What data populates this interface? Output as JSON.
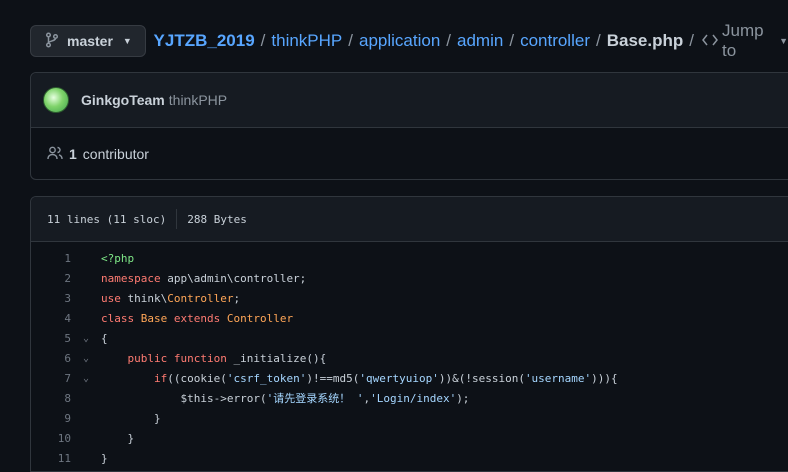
{
  "branch": {
    "label": "master"
  },
  "breadcrumb": {
    "repo": "YJTZB_2019",
    "parts": [
      "thinkPHP",
      "application",
      "admin",
      "controller"
    ],
    "file": "Base.php",
    "separator": "/",
    "jump_label": "Jump to"
  },
  "commit": {
    "author": "GinkgoTeam",
    "message": "thinkPHP"
  },
  "contributors": {
    "count": "1",
    "label": "contributor"
  },
  "file_info": {
    "lines": "11 lines (11 sloc)",
    "size": "288 Bytes"
  },
  "code": {
    "line_numbers": [
      "1",
      "2",
      "3",
      "4",
      "5",
      "6",
      "7",
      "8",
      "9",
      "10",
      "11"
    ],
    "tokens": {
      "l1": "<?php",
      "l2_kw": "namespace",
      "l2_rest": " app\\admin\\controller;",
      "l3_kw": "use",
      "l3_a": " think\\",
      "l3_cls": "Controller",
      "l3_end": ";",
      "l4_kw1": "class",
      "l4_cls1": "Base",
      "l4_kw2": "extends",
      "l4_cls2": "Controller",
      "l5": "{",
      "l6_kw1": "public",
      "l6_kw2": "function",
      "l6_fn": "_initialize",
      "l6_end": "(){",
      "l7_kw": "if",
      "l7_a": "((",
      "l7_fn1": "cookie",
      "l7_b": "(",
      "l7_s1": "'csrf_token'",
      "l7_c": ")!==",
      "l7_fn2": "md5",
      "l7_d": "(",
      "l7_s2": "'qwertyuiop'",
      "l7_e": "))&(!",
      "l7_fn3": "session",
      "l7_f": "(",
      "l7_s3": "'username'",
      "l7_g": "))){",
      "l8_var": "$this->",
      "l8_fn": "error",
      "l8_a": "(",
      "l8_s1": "'请先登录系统！ '",
      "l8_b": ",",
      "l8_s2": "'Login/index'",
      "l8_c": ");",
      "l9": "}",
      "l10": "}",
      "l11": "}"
    }
  }
}
